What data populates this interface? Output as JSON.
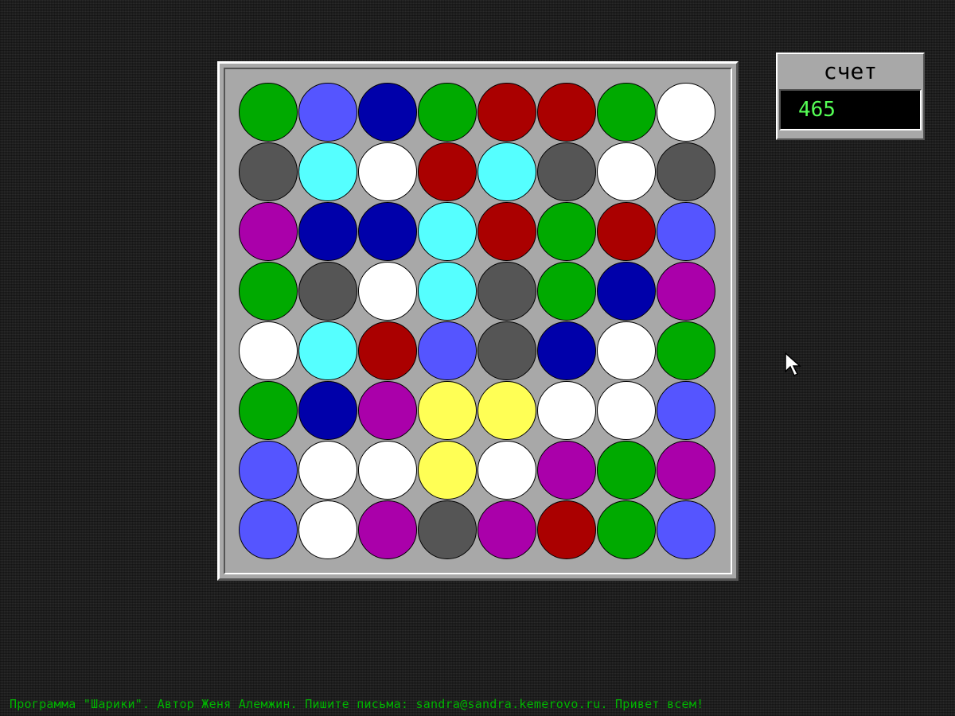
{
  "score": {
    "title": "счет",
    "value": "465"
  },
  "footer": {
    "text": "Программа \"Шарики\". Автор Женя Алемжин. Пишите письма: sandra@sandra.kemerovo.ru. Привет всем!"
  },
  "colors": {
    "green": "#00aa00",
    "lightblue": "#5555ff",
    "blue": "#0000aa",
    "red": "#aa0000",
    "white": "#ffffff",
    "gray": "#555555",
    "cyan": "#55ffff",
    "magenta": "#aa00aa",
    "yellow": "#ffff55"
  },
  "board": [
    [
      "green",
      "lightblue",
      "blue",
      "green",
      "red",
      "red",
      "green",
      "white"
    ],
    [
      "gray",
      "cyan",
      "white",
      "red",
      "cyan",
      "gray",
      "white",
      "gray"
    ],
    [
      "magenta",
      "blue",
      "blue",
      "cyan",
      "red",
      "green",
      "red",
      "lightblue"
    ],
    [
      "green",
      "gray",
      "white",
      "cyan",
      "gray",
      "green",
      "blue",
      "magenta"
    ],
    [
      "white",
      "cyan",
      "red",
      "lightblue",
      "gray",
      "blue",
      "white",
      "green"
    ],
    [
      "green",
      "blue",
      "magenta",
      "yellow",
      "yellow",
      "white",
      "white",
      "lightblue"
    ],
    [
      "lightblue",
      "white",
      "white",
      "yellow",
      "white",
      "magenta",
      "green",
      "magenta"
    ],
    [
      "lightblue",
      "white",
      "magenta",
      "gray",
      "magenta",
      "red",
      "green",
      "lightblue"
    ]
  ],
  "icons": {
    "cursor": "mouse-pointer-icon"
  }
}
